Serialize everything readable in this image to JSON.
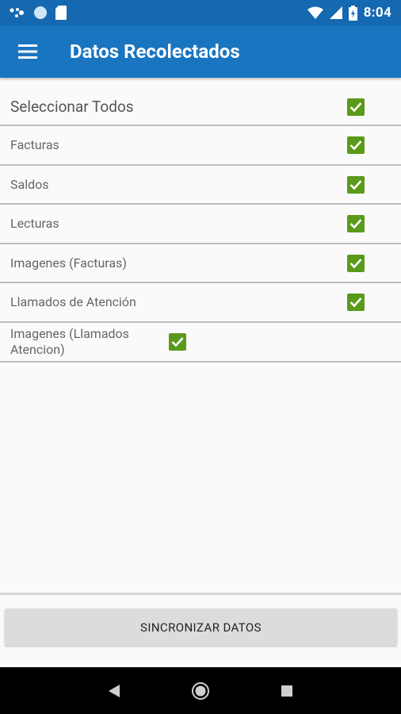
{
  "status_bar": {
    "time": "8:04",
    "icons": [
      "assistant-dots-icon",
      "circle-icon",
      "sd-card-icon",
      "wifi-icon",
      "signal-icon",
      "battery-charging-icon"
    ]
  },
  "app_bar": {
    "title": "Datos Recolectados",
    "menu_icon": "hamburger-menu-icon"
  },
  "list": {
    "select_all": {
      "label": "Seleccionar Todos",
      "checked": true
    },
    "items": [
      {
        "label": "Facturas",
        "checked": true
      },
      {
        "label": "Saldos",
        "checked": true
      },
      {
        "label": "Lecturas",
        "checked": true
      },
      {
        "label": "Imagenes (Facturas)",
        "checked": true
      },
      {
        "label": "Llamados de Atención",
        "checked": true
      },
      {
        "label": "Imagenes (Llamados Atencion)",
        "checked": true
      }
    ]
  },
  "actions": {
    "sync_label": "SINCRONIZAR DATOS"
  },
  "colors": {
    "status_bar": "#1569b0",
    "app_bar": "#1a75c0",
    "checkbox": "#5a9a1a"
  }
}
